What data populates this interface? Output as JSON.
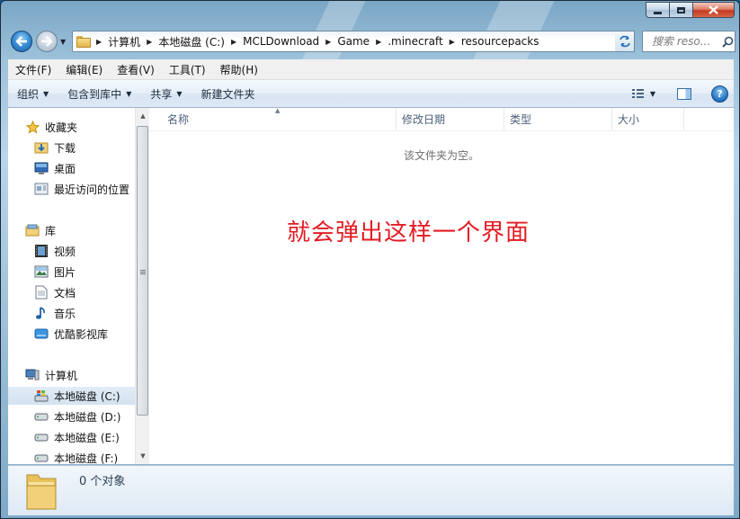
{
  "window": {
    "controls": {
      "minimize_icon": "minimize-icon",
      "maximize_icon": "maximize-icon",
      "close_icon": "close-icon"
    }
  },
  "address": {
    "crumbs": [
      "计算机",
      "本地磁盘 (C:)",
      "MCLDownload",
      "Game",
      ".minecraft",
      "resourcepacks"
    ]
  },
  "search": {
    "placeholder": "搜索 reso..."
  },
  "menu": {
    "items": [
      "文件(F)",
      "编辑(E)",
      "查看(V)",
      "工具(T)",
      "帮助(H)"
    ]
  },
  "toolbar": {
    "organize": "组织",
    "include_library": "包含到库中",
    "share": "共享",
    "new_folder": "新建文件夹"
  },
  "navpane": {
    "favorites": {
      "label": "收藏夹",
      "items": [
        "下载",
        "桌面",
        "最近访问的位置"
      ]
    },
    "libraries": {
      "label": "库",
      "items": [
        "视频",
        "图片",
        "文档",
        "音乐",
        "优酷影视库"
      ]
    },
    "computer": {
      "label": "计算机",
      "drives": [
        "本地磁盘 (C:)",
        "本地磁盘 (D:)",
        "本地磁盘 (E:)",
        "本地磁盘 (F:)"
      ],
      "selected": "本地磁盘 (C:)"
    }
  },
  "columns": {
    "name": "名称",
    "modified": "修改日期",
    "type": "类型",
    "size": "大小"
  },
  "content": {
    "empty_message": "该文件夹为空。",
    "annotation": "就会弹出这样一个界面",
    "annotation_color": "#e31b23"
  },
  "details": {
    "count": "0 个对象"
  }
}
